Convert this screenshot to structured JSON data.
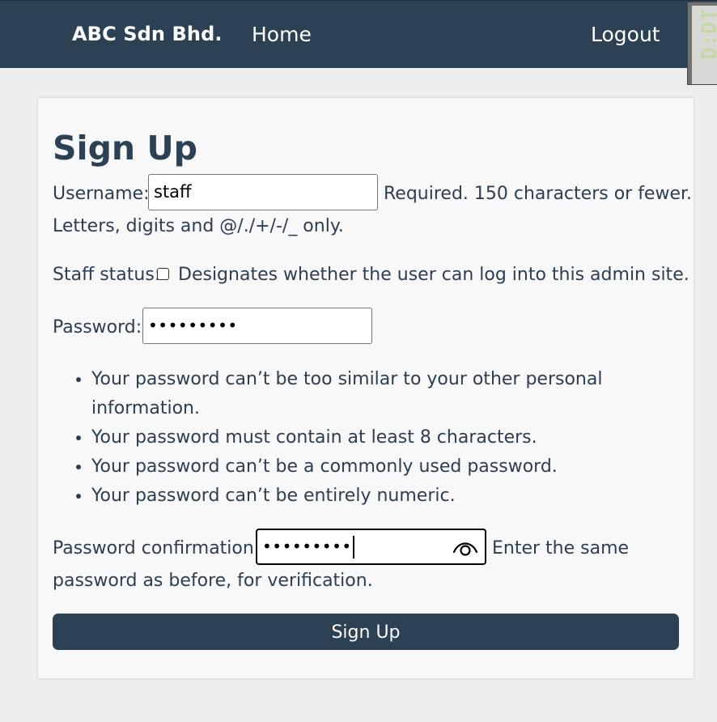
{
  "navbar": {
    "brand": "ABC Sdn Bhd.",
    "home": "Home",
    "logout": "Logout"
  },
  "extension_badge": {
    "text": "D:DT"
  },
  "form": {
    "title": "Sign Up",
    "username": {
      "label": "Username:",
      "value": "staff",
      "help_line1": "Required. 150 characters or fewer.",
      "help_line2": "Letters, digits and @/./+/-/_ only."
    },
    "staff_status": {
      "label": "Staff status:",
      "checked": false,
      "help": "Designates whether the user can log into this admin site."
    },
    "password": {
      "label": "Password:",
      "masked_value": "•••••••••"
    },
    "password_help": [
      "Your password can’t be too similar to your other personal information.",
      "Your password must contain at least 8 characters.",
      "Your password can’t be a commonly used password.",
      "Your password can’t be entirely numeric."
    ],
    "password_confirmation": {
      "label": "Password confirmation:",
      "masked_value": "•••••••••",
      "help_line1": "Enter the same",
      "help_line2": "password as before, for verification."
    },
    "submit_label": "Sign Up"
  },
  "icons": {
    "password_reveal": "eye-icon"
  }
}
